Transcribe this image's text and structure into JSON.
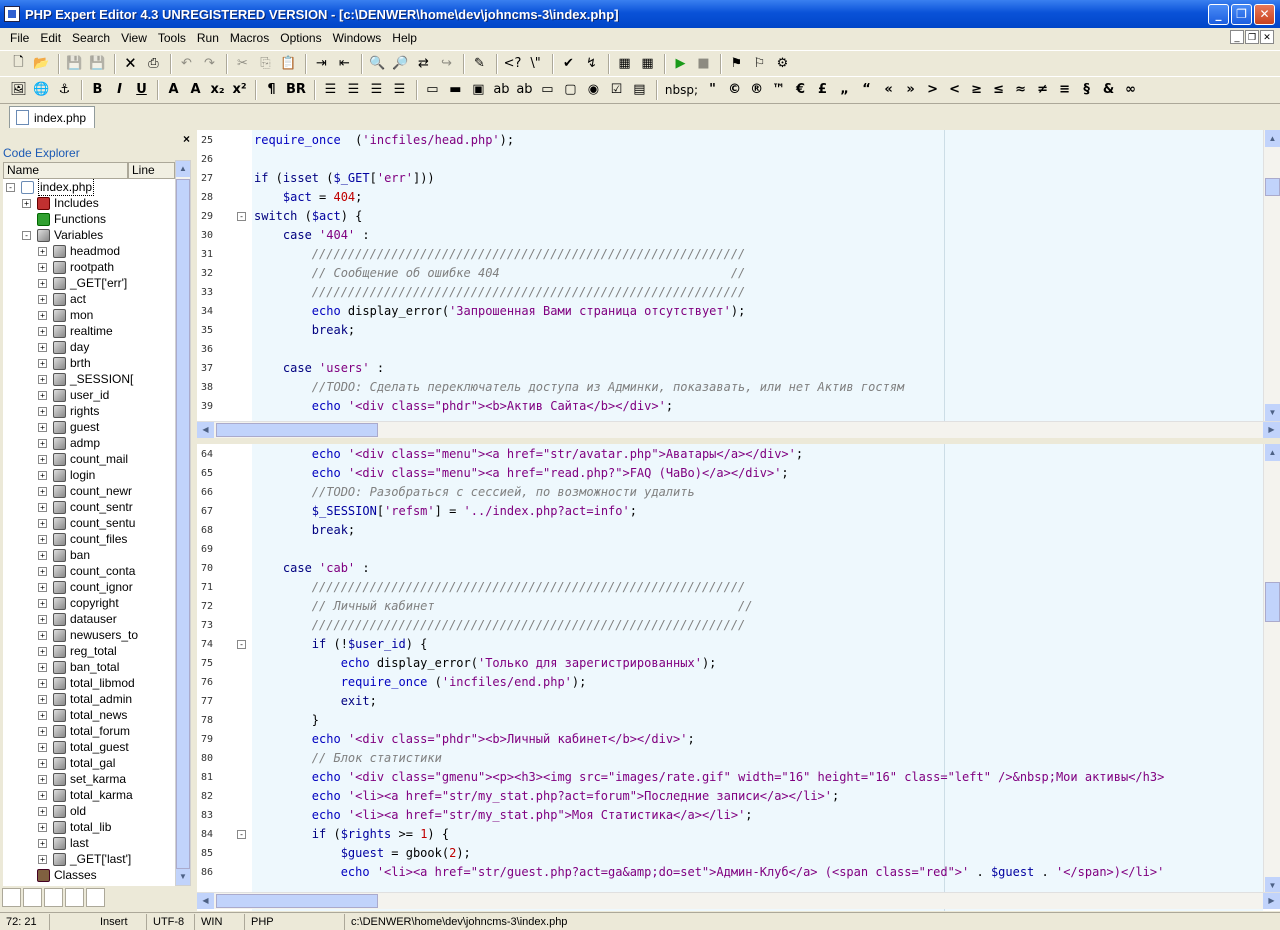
{
  "window": {
    "title": "PHP Expert Editor 4.3 UNREGISTERED VERSION - [c:\\DENWER\\home\\dev\\johncms-3\\index.php]"
  },
  "menu": [
    "File",
    "Edit",
    "Search",
    "View",
    "Tools",
    "Run",
    "Macros",
    "Options",
    "Windows",
    "Help"
  ],
  "toolbar2_glyphs": [
    "¶",
    "BR",
    "nbsp;",
    "\"",
    "©",
    "®",
    "™",
    "€",
    "£",
    "„",
    "“",
    "«",
    "»",
    ">",
    "<",
    "≥",
    "≤",
    "≈",
    "≠",
    "≡",
    "§",
    "&",
    "∞"
  ],
  "doc_tab": "index.php",
  "explorer": {
    "title": "Code Explorer",
    "col_name": "Name",
    "col_line": "Line",
    "root": "index.php",
    "includes": "Includes",
    "functions": "Functions",
    "variables": "Variables",
    "vars": [
      "headmod",
      "rootpath",
      "_GET['err']",
      "act",
      "mon",
      "realtime",
      "day",
      "brth",
      "_SESSION[",
      "user_id",
      "rights",
      "guest",
      "admp",
      "count_mail",
      "login",
      "count_newr",
      "count_sentr",
      "count_sentu",
      "count_files",
      "ban",
      "count_conta",
      "count_ignor",
      "copyright",
      "datauser",
      "newusers_to",
      "reg_total",
      "ban_total",
      "total_libmod",
      "total_admin",
      "total_news",
      "total_forum",
      "total_guest",
      "total_gal",
      "set_karma",
      "total_karma",
      "old",
      "total_lib",
      "last",
      "_GET['last']"
    ],
    "classes": "Classes"
  },
  "pane1": {
    "line_numbers": [
      "25",
      "26",
      "27",
      "28",
      "29",
      "30",
      "31",
      "32",
      "33",
      "34",
      "35",
      "36",
      "37",
      "38",
      "39"
    ],
    "folds": [
      "29"
    ],
    "lines": [
      [
        [
          "kw",
          "require_once"
        ],
        [
          "",
          "  ("
        ],
        [
          "s",
          "'incfiles/head.php'"
        ],
        [
          "",
          ");"
        ]
      ],
      [],
      [
        [
          "k",
          "if"
        ],
        [
          "",
          " ("
        ],
        [
          "k",
          "isset"
        ],
        [
          "",
          " ("
        ],
        [
          "v",
          "$_GET"
        ],
        [
          "",
          "["
        ],
        [
          "s",
          "'err'"
        ],
        [
          "",
          "]))"
        ]
      ],
      [
        [
          "",
          ""
        ],
        [
          "v",
          "    $act"
        ],
        [
          "",
          " = "
        ],
        [
          "n",
          "404"
        ],
        [
          "",
          ";"
        ]
      ],
      [
        [
          "k",
          "switch"
        ],
        [
          "",
          " ("
        ],
        [
          "v",
          "$act"
        ],
        [
          "",
          ") {"
        ]
      ],
      [
        [
          "k",
          "    case"
        ],
        [
          "",
          " "
        ],
        [
          "s",
          "'404'"
        ],
        [
          "",
          " :"
        ]
      ],
      [
        [
          "c",
          "        ////////////////////////////////////////////////////////////"
        ]
      ],
      [
        [
          "c",
          "        // Сообщение об ошибке 404                                //"
        ]
      ],
      [
        [
          "c",
          "        ////////////////////////////////////////////////////////////"
        ]
      ],
      [
        [
          "kw",
          "        echo"
        ],
        [
          "",
          " display_error("
        ],
        [
          "s",
          "'Запрошенная Вами страница отсутствует'"
        ],
        [
          "",
          ");"
        ]
      ],
      [
        [
          "k",
          "        break"
        ],
        [
          "",
          ";"
        ]
      ],
      [],
      [
        [
          "k",
          "    case"
        ],
        [
          "",
          " "
        ],
        [
          "s",
          "'users'"
        ],
        [
          "",
          " :"
        ]
      ],
      [
        [
          "c",
          "        //TODO: Сделать переключатель доступа из Админки, показавать, или нет Актив гостям"
        ]
      ],
      [
        [
          "kw",
          "        echo"
        ],
        [
          "",
          " "
        ],
        [
          "s",
          "'<div class=\"phdr\"><b>Актив Сайта</b></div>'"
        ],
        [
          "",
          ";"
        ]
      ]
    ]
  },
  "pane2": {
    "line_numbers": [
      "64",
      "65",
      "66",
      "67",
      "68",
      "69",
      "70",
      "71",
      "72",
      "73",
      "74",
      "75",
      "76",
      "77",
      "78",
      "79",
      "80",
      "81",
      "82",
      "83",
      "84",
      "85",
      "86"
    ],
    "folds": [
      "74",
      "84"
    ],
    "lines": [
      [
        [
          "kw",
          "        echo"
        ],
        [
          "",
          " "
        ],
        [
          "s",
          "'<div class=\"menu\"><a href=\"str/avatar.php\">Аватары</a></div>'"
        ],
        [
          "",
          ";"
        ]
      ],
      [
        [
          "kw",
          "        echo"
        ],
        [
          "",
          " "
        ],
        [
          "s",
          "'<div class=\"menu\"><a href=\"read.php?\">FAQ (ЧаВо)</a></div>'"
        ],
        [
          "",
          ";"
        ]
      ],
      [
        [
          "c",
          "        //TODO: Разобраться с сессией, по возможности удалить"
        ]
      ],
      [
        [
          "v",
          "        $_SESSION"
        ],
        [
          "",
          "["
        ],
        [
          "s",
          "'refsm'"
        ],
        [
          "",
          "] = "
        ],
        [
          "s",
          "'../index.php?act=info'"
        ],
        [
          "",
          ";"
        ]
      ],
      [
        [
          "k",
          "        break"
        ],
        [
          "",
          ";"
        ]
      ],
      [],
      [
        [
          "k",
          "    case"
        ],
        [
          "",
          " "
        ],
        [
          "s",
          "'cab'"
        ],
        [
          "",
          " :"
        ]
      ],
      [
        [
          "c",
          "        ////////////////////////////////////////////////////////////"
        ]
      ],
      [
        [
          "c",
          "        // Личный кабинет                                          //"
        ]
      ],
      [
        [
          "c",
          "        ////////////////////////////////////////////////////////////"
        ]
      ],
      [
        [
          "k",
          "        if"
        ],
        [
          "",
          " (!"
        ],
        [
          "v",
          "$user_id"
        ],
        [
          "",
          ") {"
        ]
      ],
      [
        [
          "kw",
          "            echo"
        ],
        [
          "",
          " display_error("
        ],
        [
          "s",
          "'Только для зарегистрированных'"
        ],
        [
          "",
          ");"
        ]
      ],
      [
        [
          "kw",
          "            require_once"
        ],
        [
          "",
          " ("
        ],
        [
          "s",
          "'incfiles/end.php'"
        ],
        [
          "",
          ");"
        ]
      ],
      [
        [
          "k",
          "            exit"
        ],
        [
          "",
          ";"
        ]
      ],
      [
        [
          "",
          "        }"
        ]
      ],
      [
        [
          "kw",
          "        echo"
        ],
        [
          "",
          " "
        ],
        [
          "s",
          "'<div class=\"phdr\"><b>Личный кабинет</b></div>'"
        ],
        [
          "",
          ";"
        ]
      ],
      [
        [
          "c",
          "        // Блок статистики"
        ]
      ],
      [
        [
          "kw",
          "        echo"
        ],
        [
          "",
          " "
        ],
        [
          "s",
          "'<div class=\"gmenu\"><p><h3><img src=\"images/rate.gif\" width=\"16\" height=\"16\" class=\"left\" />&nbsp;Мои активы</h3>"
        ]
      ],
      [
        [
          "kw",
          "        echo"
        ],
        [
          "",
          " "
        ],
        [
          "s",
          "'<li><a href=\"str/my_stat.php?act=forum\">Последние записи</a></li>'"
        ],
        [
          "",
          ";"
        ]
      ],
      [
        [
          "kw",
          "        echo"
        ],
        [
          "",
          " "
        ],
        [
          "s",
          "'<li><a href=\"str/my_stat.php\">Моя Статистика</a></li>'"
        ],
        [
          "",
          ";"
        ]
      ],
      [
        [
          "k",
          "        if"
        ],
        [
          "",
          " ("
        ],
        [
          "v",
          "$rights"
        ],
        [
          "",
          " >= "
        ],
        [
          "n",
          "1"
        ],
        [
          "",
          ") {"
        ]
      ],
      [
        [
          "v",
          "            $guest"
        ],
        [
          "",
          " = gbook("
        ],
        [
          "n",
          "2"
        ],
        [
          "",
          ");"
        ]
      ],
      [
        [
          "kw",
          "            echo"
        ],
        [
          "",
          " "
        ],
        [
          "s",
          "'<li><a href=\"str/guest.php?act=ga&amp;do=set\">Админ-Клуб</a> (<span class=\"red\">'"
        ],
        [
          "",
          " . "
        ],
        [
          "v",
          "$guest"
        ],
        [
          "",
          " . "
        ],
        [
          "s",
          "'</span>)</li>'"
        ]
      ]
    ]
  },
  "status": {
    "pos": "72: 21",
    "mode": "Insert",
    "enc": "UTF-8",
    "eol": "WIN",
    "lang": "PHP",
    "path": "c:\\DENWER\\home\\dev\\johncms-3\\index.php"
  }
}
